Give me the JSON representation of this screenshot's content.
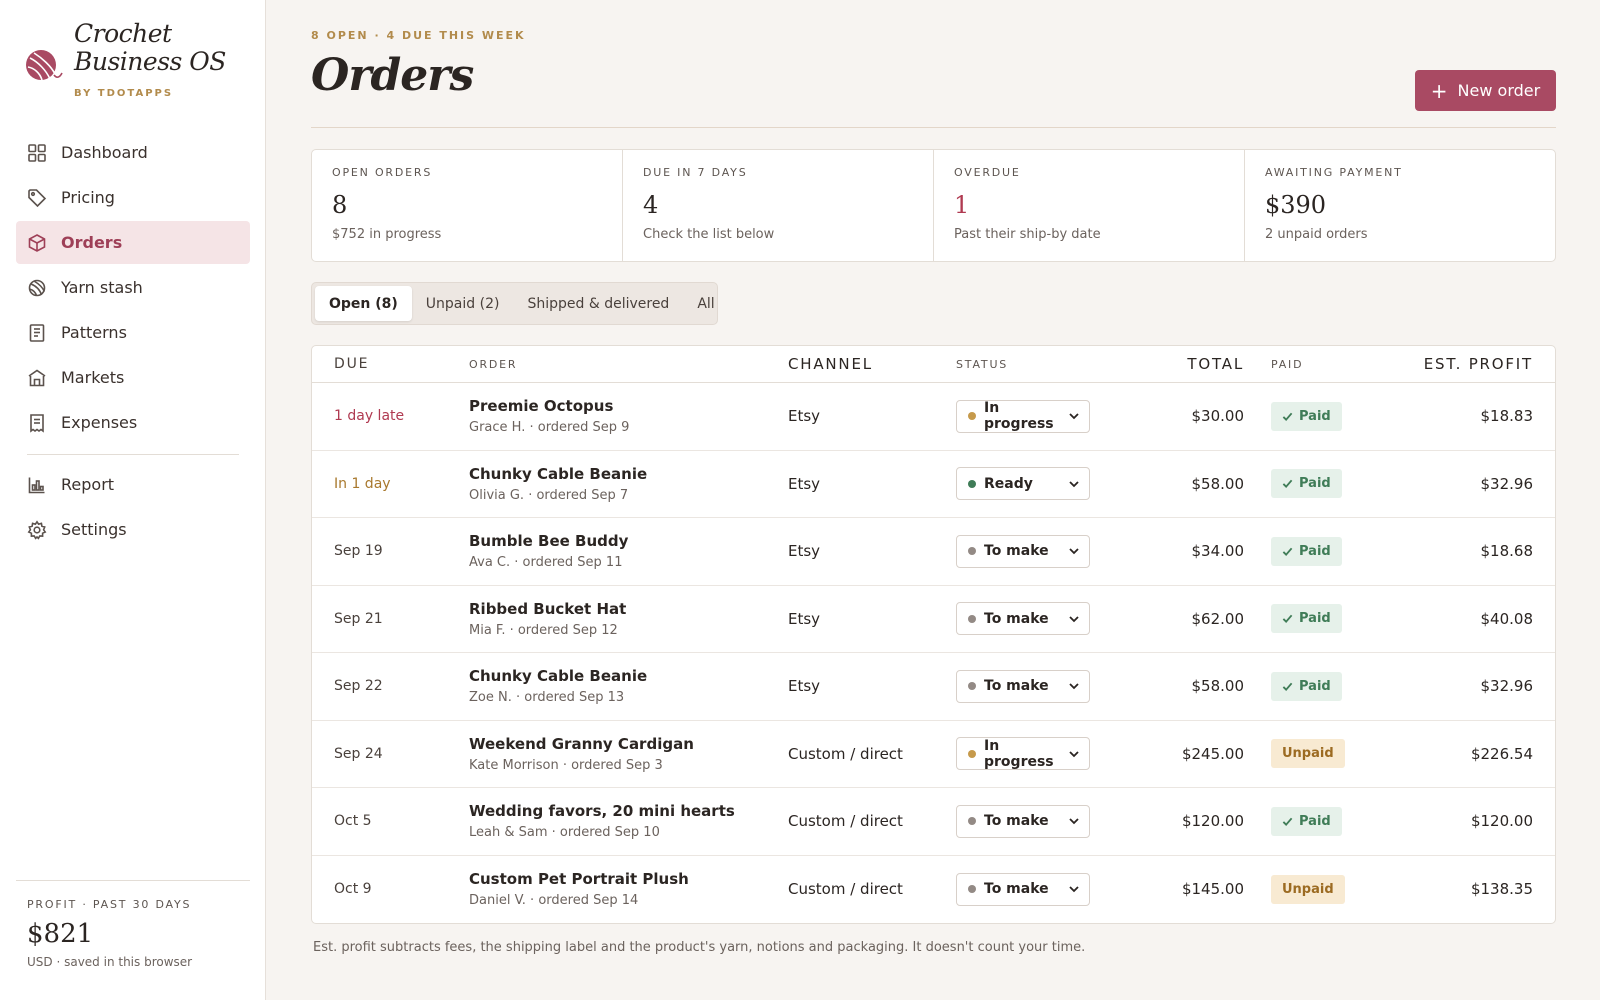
{
  "brand": {
    "name": "Crochet\nBusiness OS",
    "byline": "BY TDOTAPPS",
    "accent": "#a94a63"
  },
  "sidebar": {
    "items": [
      {
        "label": "Dashboard",
        "icon": "grid-icon",
        "active": false
      },
      {
        "label": "Pricing",
        "icon": "tag-icon",
        "active": false
      },
      {
        "label": "Orders",
        "icon": "box-icon",
        "active": true
      },
      {
        "label": "Yarn stash",
        "icon": "yarn-icon",
        "active": false
      },
      {
        "label": "Patterns",
        "icon": "book-icon",
        "active": false
      },
      {
        "label": "Markets",
        "icon": "store-icon",
        "active": false
      },
      {
        "label": "Expenses",
        "icon": "receipt-icon",
        "active": false
      }
    ],
    "secondary": [
      {
        "label": "Report",
        "icon": "bar-chart-icon"
      },
      {
        "label": "Settings",
        "icon": "gear-icon"
      }
    ],
    "footer": {
      "label": "PROFIT · PAST 30 DAYS",
      "value": "$821",
      "note": "USD · saved in this browser"
    }
  },
  "header": {
    "kicker": "8 OPEN · 4 DUE THIS WEEK",
    "title": "Orders",
    "new_order_label": "New order"
  },
  "stats": [
    {
      "label": "OPEN ORDERS",
      "value": "8",
      "sub": "$752 in progress",
      "alert": false
    },
    {
      "label": "DUE IN 7 DAYS",
      "value": "4",
      "sub": "Check the list below",
      "alert": false
    },
    {
      "label": "OVERDUE",
      "value": "1",
      "sub": "Past their ship-by date",
      "alert": true
    },
    {
      "label": "AWAITING PAYMENT",
      "value": "$390",
      "sub": "2 unpaid orders",
      "alert": false
    }
  ],
  "tabs": [
    {
      "label": "Open (8)",
      "active": true
    },
    {
      "label": "Unpaid (2)",
      "active": false
    },
    {
      "label": "Shipped & delivered",
      "active": false
    },
    {
      "label": "All",
      "active": false
    }
  ],
  "table": {
    "columns": {
      "due": "DUE",
      "order": "ORDER",
      "channel": "CHANNEL",
      "status": "STATUS",
      "total": "TOTAL",
      "paid": "PAID",
      "profit": "EST. PROFIT"
    },
    "rows": [
      {
        "due": "1 day late",
        "due_tone": "late",
        "name": "Preemie Octopus",
        "meta": "Grace H. · ordered Sep 9",
        "channel": "Etsy",
        "status": "In progress",
        "status_color": "#c69a4b",
        "total": "$30.00",
        "paid": "Paid",
        "paid_state": "paid",
        "profit": "$18.83"
      },
      {
        "due": "In 1 day",
        "due_tone": "soon",
        "name": "Chunky Cable Beanie",
        "meta": "Olivia G. · ordered Sep 7",
        "channel": "Etsy",
        "status": "Ready",
        "status_color": "#3f7c57",
        "total": "$58.00",
        "paid": "Paid",
        "paid_state": "paid",
        "profit": "$32.96"
      },
      {
        "due": "Sep 19",
        "due_tone": "normal",
        "name": "Bumble Bee Buddy",
        "meta": "Ava C. · ordered Sep 11",
        "channel": "Etsy",
        "status": "To make",
        "status_color": "#938a85",
        "total": "$34.00",
        "paid": "Paid",
        "paid_state": "paid",
        "profit": "$18.68"
      },
      {
        "due": "Sep 21",
        "due_tone": "normal",
        "name": "Ribbed Bucket Hat",
        "meta": "Mia F. · ordered Sep 12",
        "channel": "Etsy",
        "status": "To make",
        "status_color": "#938a85",
        "total": "$62.00",
        "paid": "Paid",
        "paid_state": "paid",
        "profit": "$40.08"
      },
      {
        "due": "Sep 22",
        "due_tone": "normal",
        "name": "Chunky Cable Beanie",
        "meta": "Zoe N. · ordered Sep 13",
        "channel": "Etsy",
        "status": "To make",
        "status_color": "#938a85",
        "total": "$58.00",
        "paid": "Paid",
        "paid_state": "paid",
        "profit": "$32.96"
      },
      {
        "due": "Sep 24",
        "due_tone": "normal",
        "name": "Weekend Granny Cardigan",
        "meta": "Kate Morrison · ordered Sep 3",
        "channel": "Custom / direct",
        "status": "In progress",
        "status_color": "#c69a4b",
        "total": "$245.00",
        "paid": "Unpaid",
        "paid_state": "unpaid",
        "profit": "$226.54"
      },
      {
        "due": "Oct 5",
        "due_tone": "normal",
        "name": "Wedding favors, 20 mini hearts",
        "meta": "Leah & Sam · ordered Sep 10",
        "channel": "Custom / direct",
        "status": "To make",
        "status_color": "#938a85",
        "total": "$120.00",
        "paid": "Paid",
        "paid_state": "paid",
        "profit": "$120.00"
      },
      {
        "due": "Oct 9",
        "due_tone": "normal",
        "name": "Custom Pet Portrait Plush",
        "meta": "Daniel V. · ordered Sep 14",
        "channel": "Custom / direct",
        "status": "To make",
        "status_color": "#938a85",
        "total": "$145.00",
        "paid": "Unpaid",
        "paid_state": "unpaid",
        "profit": "$138.35"
      }
    ]
  },
  "footnote": "Est. profit subtracts fees, the shipping label and the product's yarn, notions and packaging. It doesn't count your time."
}
